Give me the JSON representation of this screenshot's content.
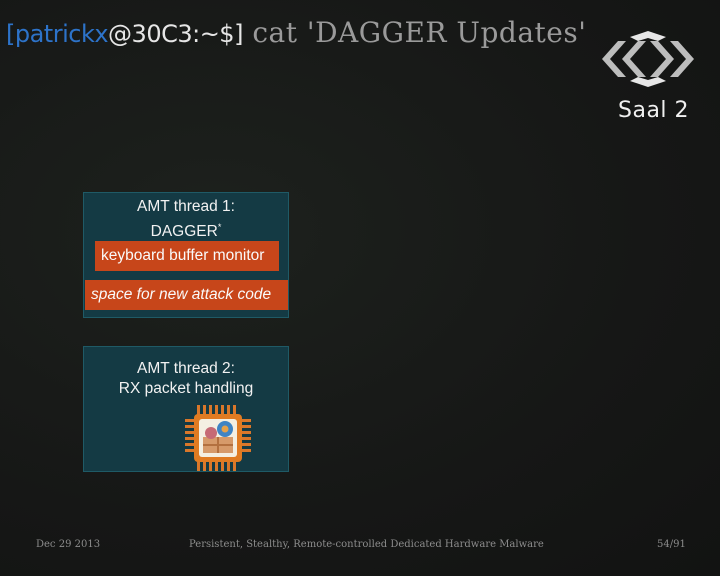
{
  "header": {
    "prompt_user": "[patrickx",
    "prompt_host": "@30C3:~$]",
    "command": " cat 'DAGGER Updates'"
  },
  "branding": {
    "logo_icon": "30c3-logo-icon",
    "room": "Saal 2"
  },
  "thread1": {
    "title_line1": "AMT thread 1:",
    "title_line2": "DAGGER",
    "title_mark": "*",
    "item1": "keyboard buffer monitor",
    "item2": "space for new attack code"
  },
  "thread2": {
    "title_line1": "AMT thread 2:",
    "title_line2": "RX packet handling",
    "chip_icon": "cpu-chip-icon"
  },
  "footer": {
    "date": "Dec 29 2013",
    "title": "Persistent, Stealthy, Remote-controlled Dedicated Hardware Malware",
    "page": "54/91"
  },
  "colors": {
    "background": "#151515",
    "prompt_user": "#2d73c9",
    "box_fill": "#143a44",
    "bar_fill": "#c7461a"
  }
}
